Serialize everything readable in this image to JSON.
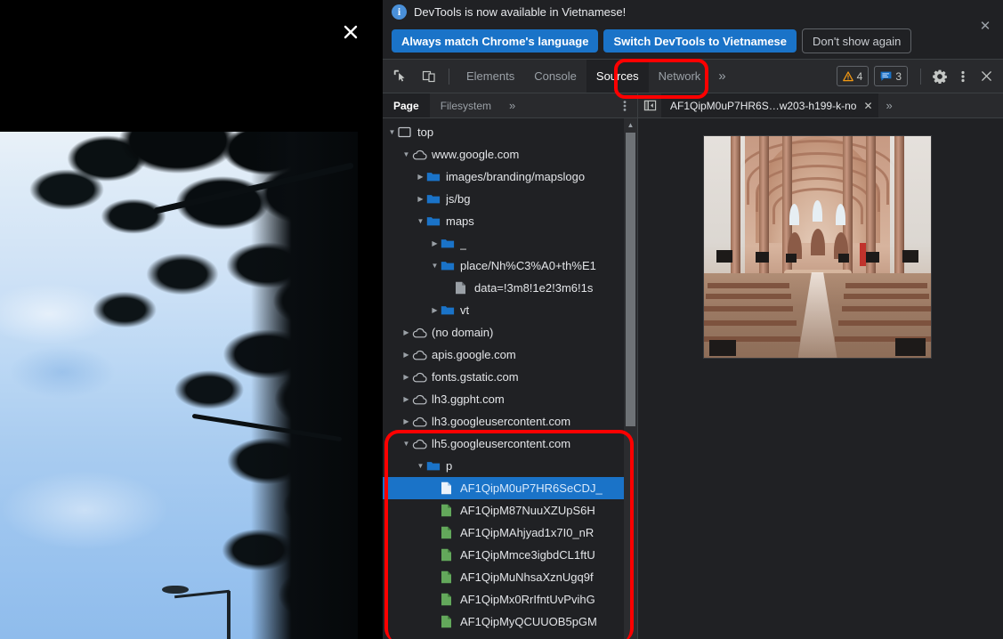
{
  "lightbox": {
    "close_label": "✕",
    "photo_alt": "tree canopy against blue sky"
  },
  "banner": {
    "icon": "info-icon",
    "message": "DevTools is now available in Vietnamese!",
    "buttons": [
      {
        "label": "Always match Chrome's language",
        "style": "primary"
      },
      {
        "label": "Switch DevTools to Vietnamese",
        "style": "primary"
      },
      {
        "label": "Don't show again",
        "style": "ghost"
      }
    ],
    "close_label": "✕"
  },
  "toolbar": {
    "inspect_icon": "inspect-cursor-icon",
    "device_icon": "device-toolbar-icon",
    "tabs": [
      {
        "label": "Elements",
        "active": false
      },
      {
        "label": "Console",
        "active": false
      },
      {
        "label": "Sources",
        "active": true
      },
      {
        "label": "Network",
        "active": false
      }
    ],
    "more_tabs_label": "»",
    "warning_count": "4",
    "warning_color": "#f29913",
    "message_count": "3",
    "message_color": "#1a73c8",
    "settings_icon": "gear-icon",
    "kebab_icon": "kebab-menu-icon",
    "close_icon": "close-icon"
  },
  "nav": {
    "tabs": [
      {
        "label": "Page",
        "active": true
      },
      {
        "label": "Filesystem",
        "active": false
      }
    ],
    "more_label": "»",
    "kebab_icon": "kebab-menu-icon"
  },
  "tree": [
    {
      "depth": 0,
      "twisty": "open",
      "icon": "frame",
      "label": "top",
      "selected": false
    },
    {
      "depth": 1,
      "twisty": "open",
      "icon": "cloud",
      "label": "www.google.com",
      "selected": false
    },
    {
      "depth": 2,
      "twisty": "closed",
      "icon": "folder",
      "label": "images/branding/mapslogo",
      "selected": false
    },
    {
      "depth": 2,
      "twisty": "closed",
      "icon": "folder",
      "label": "js/bg",
      "selected": false
    },
    {
      "depth": 2,
      "twisty": "open",
      "icon": "folder",
      "label": "maps",
      "selected": false
    },
    {
      "depth": 3,
      "twisty": "closed",
      "icon": "folder",
      "label": "_",
      "selected": false
    },
    {
      "depth": 3,
      "twisty": "open",
      "icon": "folder",
      "label": "place/Nh%C3%A0+th%E1",
      "selected": false
    },
    {
      "depth": 4,
      "twisty": "none",
      "icon": "doc",
      "label": "data=!3m8!1e2!3m6!1s",
      "selected": false
    },
    {
      "depth": 3,
      "twisty": "closed",
      "icon": "folder",
      "label": "vt",
      "selected": false
    },
    {
      "depth": 1,
      "twisty": "closed",
      "icon": "cloud",
      "label": "(no domain)",
      "selected": false
    },
    {
      "depth": 1,
      "twisty": "closed",
      "icon": "cloud",
      "label": "apis.google.com",
      "selected": false
    },
    {
      "depth": 1,
      "twisty": "closed",
      "icon": "cloud",
      "label": "fonts.gstatic.com",
      "selected": false
    },
    {
      "depth": 1,
      "twisty": "closed",
      "icon": "cloud",
      "label": "lh3.ggpht.com",
      "selected": false
    },
    {
      "depth": 1,
      "twisty": "closed",
      "icon": "cloud",
      "label": "lh3.googleusercontent.com",
      "selected": false
    },
    {
      "depth": 1,
      "twisty": "open",
      "icon": "cloud",
      "label": "lh5.googleusercontent.com",
      "selected": false
    },
    {
      "depth": 2,
      "twisty": "open",
      "icon": "folder",
      "label": "p",
      "selected": false
    },
    {
      "depth": 3,
      "twisty": "none",
      "icon": "img-sel",
      "label": "AF1QipM0uP7HR6SeCDJ_",
      "selected": true
    },
    {
      "depth": 3,
      "twisty": "none",
      "icon": "img",
      "label": "AF1QipM87NuuXZUpS6H",
      "selected": false
    },
    {
      "depth": 3,
      "twisty": "none",
      "icon": "img",
      "label": "AF1QipMAhjyad1x7I0_nR",
      "selected": false
    },
    {
      "depth": 3,
      "twisty": "none",
      "icon": "img",
      "label": "AF1QipMmce3igbdCL1ftU",
      "selected": false
    },
    {
      "depth": 3,
      "twisty": "none",
      "icon": "img",
      "label": "AF1QipMuNhsaXznUgq9f",
      "selected": false
    },
    {
      "depth": 3,
      "twisty": "none",
      "icon": "img",
      "label": "AF1QipMx0RrIfntUvPvihG",
      "selected": false
    },
    {
      "depth": 3,
      "twisty": "none",
      "icon": "img",
      "label": "AF1QipMyQCUUOB5pGM",
      "selected": false
    }
  ],
  "editor": {
    "pane_toggle_icon": "show-navigator-icon",
    "tab_label": "AF1QipM0uP7HR6S…w203-h199-k-no",
    "tab_close": "✕",
    "more_label": "»",
    "preview_alt": "cathedral interior photograph"
  },
  "annotations": {
    "highlight_color": "#ff0000",
    "targets": [
      "sources-tab",
      "lh5-googleusercontent-subtree"
    ]
  }
}
